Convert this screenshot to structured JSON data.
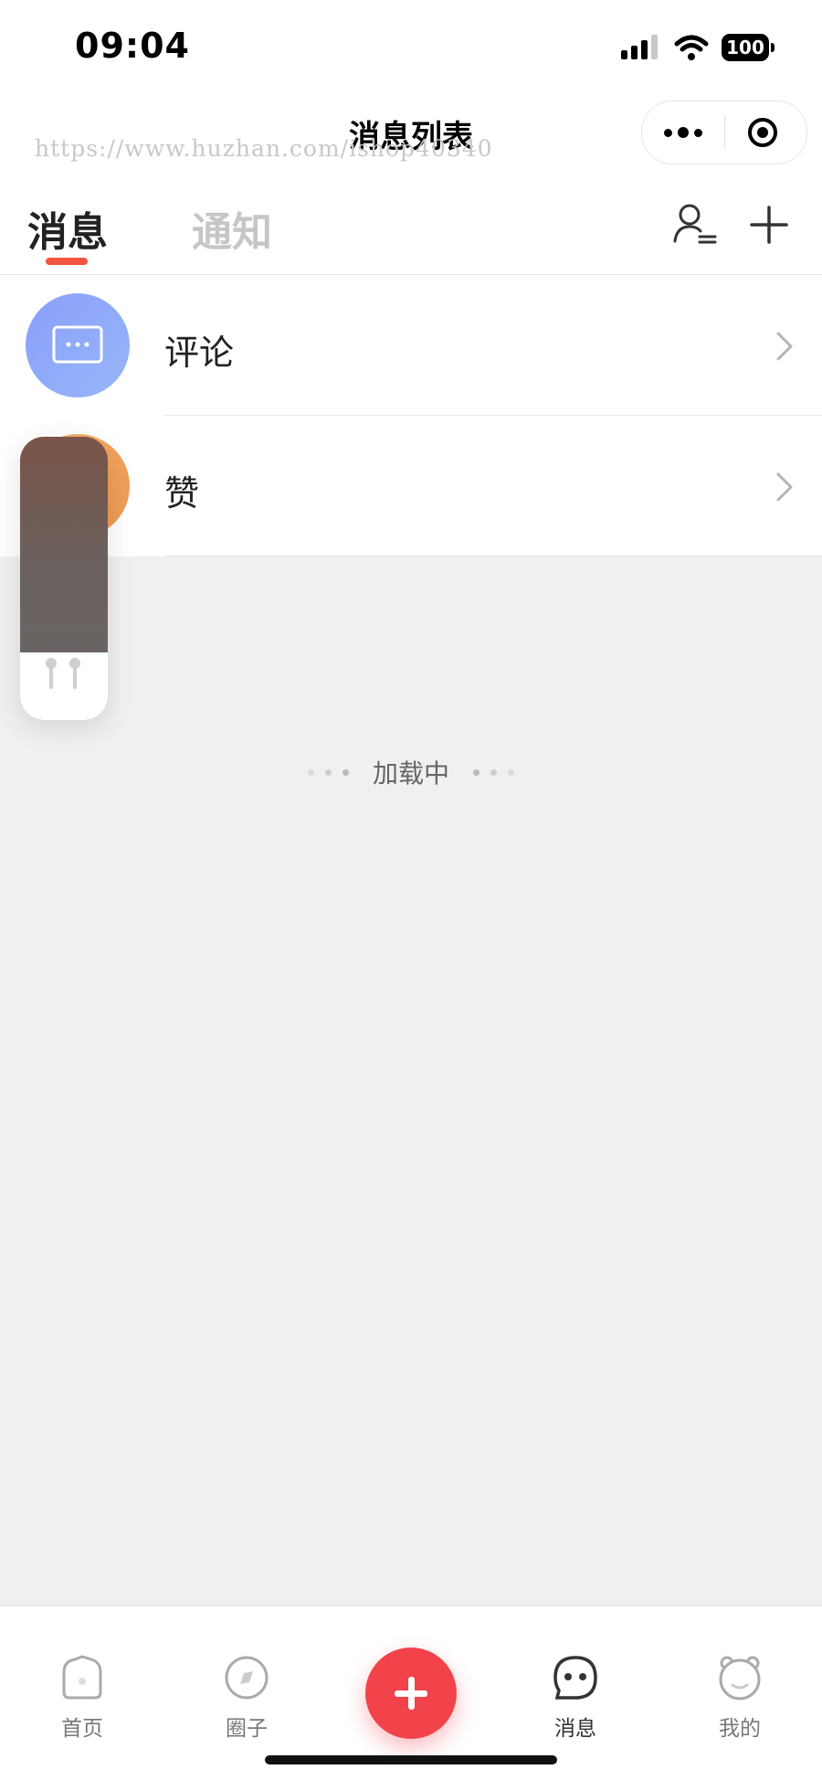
{
  "status_bar": {
    "time": "09:04",
    "battery": "100"
  },
  "nav": {
    "title": "消息列表",
    "watermark": "https://www.huzhan.com/ishop40340"
  },
  "tabs": [
    {
      "label": "消息",
      "active": true
    },
    {
      "label": "通知",
      "active": false
    }
  ],
  "icons": {
    "contacts": "user-list-icon",
    "add": "plus-icon",
    "more": "more-dots-icon",
    "target": "target-circle-icon"
  },
  "list": [
    {
      "label": "评论",
      "icon": "comment-bubble-icon",
      "color": "#8fa3fb"
    },
    {
      "label": "赞",
      "icon": "thumb-up-icon",
      "color": "#f3a461"
    }
  ],
  "loading_text": "加载中",
  "tabbar": [
    {
      "label": "首页",
      "icon": "home-icon",
      "active": false
    },
    {
      "label": "圈子",
      "icon": "compass-icon",
      "active": false
    },
    {
      "label": "",
      "icon": "plus-icon",
      "active": false
    },
    {
      "label": "消息",
      "icon": "message-face-icon",
      "active": true
    },
    {
      "label": "我的",
      "icon": "profile-bear-icon",
      "active": false
    }
  ],
  "colors": {
    "accent": "#f2553f",
    "post_button": "#f2434b",
    "background": "#f0f0f0"
  }
}
